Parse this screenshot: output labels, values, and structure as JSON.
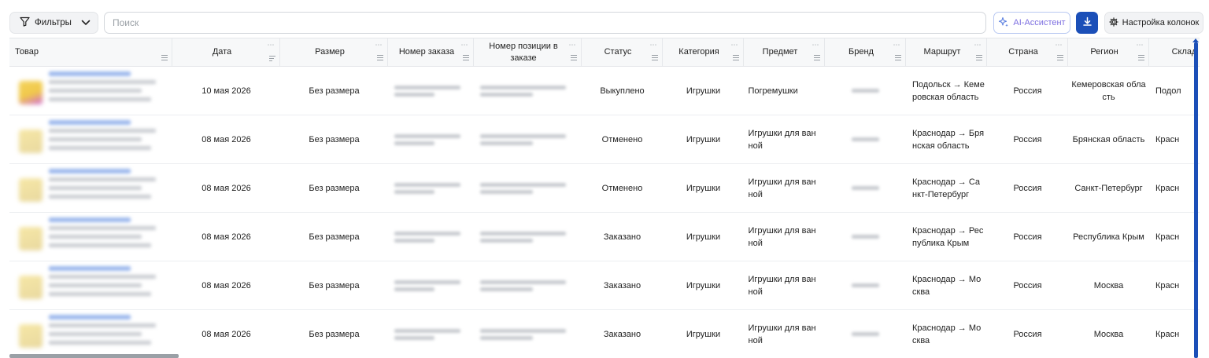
{
  "toolbar": {
    "filters_label": "Фильтры",
    "search_placeholder": "Поиск",
    "ai_label": "AI-Ассистент",
    "columns_label": "Настройка колонок"
  },
  "columns": [
    {
      "label": "Товар"
    },
    {
      "label": "Дата"
    },
    {
      "label": "Размер"
    },
    {
      "label": "Номер заказа"
    },
    {
      "label": "Номер позиции в заказе"
    },
    {
      "label": "Статус"
    },
    {
      "label": "Категория"
    },
    {
      "label": "Предмет"
    },
    {
      "label": "Бренд"
    },
    {
      "label": "Маршрут"
    },
    {
      "label": "Страна"
    },
    {
      "label": "Регион"
    },
    {
      "label": "Склад"
    }
  ],
  "rows": [
    {
      "date": "10 мая 2026",
      "size": "Без размера",
      "status": "Выкуплено",
      "category": "Игрушки",
      "subject": "Погремушки",
      "route": "Подольск → Кемеровская область",
      "country": "Россия",
      "region": "Кемеровская область",
      "warehouse": "Подол"
    },
    {
      "date": "08 мая 2026",
      "size": "Без размера",
      "status": "Отменено",
      "category": "Игрушки",
      "subject": "Игрушки для ванной",
      "route": "Краснодар → Брянская область",
      "country": "Россия",
      "region": "Брянская область",
      "warehouse": "Красн"
    },
    {
      "date": "08 мая 2026",
      "size": "Без размера",
      "status": "Отменено",
      "category": "Игрушки",
      "subject": "Игрушки для ванной",
      "route": "Краснодар → Санкт-Петербург",
      "country": "Россия",
      "region": "Санкт-Петербург",
      "warehouse": "Красн"
    },
    {
      "date": "08 мая 2026",
      "size": "Без размера",
      "status": "Заказано",
      "category": "Игрушки",
      "subject": "Игрушки для ванной",
      "route": "Краснодар → Республика Крым",
      "country": "Россия",
      "region": "Республика Крым",
      "warehouse": "Красн"
    },
    {
      "date": "08 мая 2026",
      "size": "Без размера",
      "status": "Заказано",
      "category": "Игрушки",
      "subject": "Игрушки для ванной",
      "route": "Краснодар → Москва",
      "country": "Россия",
      "region": "Москва",
      "warehouse": "Красн"
    },
    {
      "date": "08 мая 2026",
      "size": "Без размера",
      "status": "Заказано",
      "category": "Игрушки",
      "subject": "Игрушки для ванной",
      "route": "Краснодар → Москва",
      "country": "Россия",
      "region": "Москва",
      "warehouse": "Красн"
    }
  ],
  "colors": {
    "accent": "#1b4fb8",
    "ai_text": "#7c6ee0",
    "header_bg": "#f7f8f9"
  }
}
